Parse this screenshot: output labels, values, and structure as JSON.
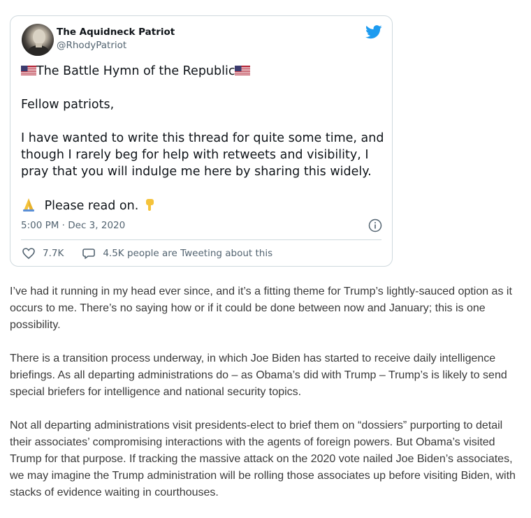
{
  "tweet": {
    "display_name": "The Aquidneck Patriot",
    "handle": "@RhodyPatriot",
    "title": "The Battle Hymn of the Republic",
    "greeting": "Fellow patriots,",
    "body": "I have wanted to write this thread for quite some time, and though I rarely beg for help with retweets and visibility, I pray that you will indulge me here by sharing this widely.",
    "cta": "Please read on.",
    "timestamp": "5:00 PM · Dec 3, 2020",
    "likes": "7.7K",
    "conversation": "4.5K people are Tweeting about this",
    "icons": {
      "avatar": "george-washington-portrait",
      "brand": "twitter-bird-icon",
      "flag": "us-flag-emoji",
      "pray": "folded-hands-emoji",
      "point": "pointing-down-emoji",
      "info": "info-icon",
      "like": "heart-icon",
      "reply": "speech-bubble-icon"
    },
    "colors": {
      "brand": "#1d9bf0",
      "muted": "#536471",
      "border": "#cfd9de"
    }
  },
  "article": {
    "paragraphs": [
      "I’ve had it running in my head ever since, and it’s a fitting theme for Trump’s lightly-sauced option as it occurs to me.  There’s no saying how or if it could be done between now and January; this is one possibility.",
      "There is a transition process underway, in which Joe Biden has started to receive daily intelligence briefings.  As all departing administrations do – as Obama’s did with Trump – Trump’s is likely to send special briefers for intelligence and national security topics.",
      "Not all departing administrations visit presidents-elect to brief them on “dossiers” purporting to detail their associates’ compromising interactions with the agents of foreign powers.  But Obama’s visited Trump for that purpose.  If tracking the massive attack on the 2020 vote nailed Joe Biden’s associates, we may imagine the Trump administration will be rolling those associates up before visiting Biden, with stacks of evidence waiting in courthouses."
    ]
  }
}
